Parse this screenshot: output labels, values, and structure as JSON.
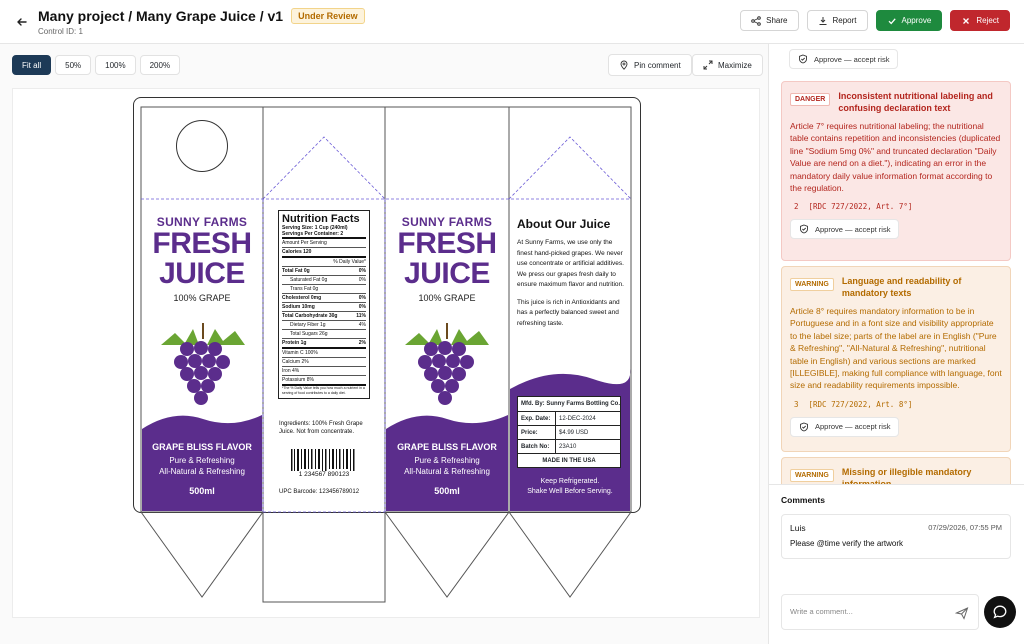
{
  "header": {
    "title": "Many project / Many Grape Juice / v1",
    "status_badge": "Under Review",
    "control_id": "Control ID: 1",
    "share": "Share",
    "report": "Report",
    "approve": "Approve",
    "reject": "Reject"
  },
  "toolbar": {
    "zoom": [
      "Fit all",
      "50%",
      "100%",
      "200%"
    ],
    "pin_comment": "Pin comment",
    "maximize": "Maximize"
  },
  "artwork": {
    "brand_top": "SUNNY FARMS",
    "brand_line1": "FRESH",
    "brand_line2": "JUICE",
    "brand_sub": "100% GRAPE",
    "flavor": "GRAPE BLISS FLAVOR",
    "tag1": "Pure & Refreshing",
    "tag2": "All-Natural & Refreshing",
    "volume": "500ml",
    "nutrition": {
      "title": "Nutrition Facts",
      "serving_size": "Serving Size: 1 Cup (240ml)",
      "servings": "Servings Per Container: 2",
      "amount": "Amount Per Serving",
      "calories": "Calories 120",
      "dv_header": "% Daily Value*",
      "rows": [
        {
          "label": "Total Fat 0g",
          "value": "0%"
        },
        {
          "label": "Saturated Fat 0g",
          "value": "0%"
        },
        {
          "label": "Trans Fat 0g",
          "value": ""
        },
        {
          "label": "Cholesterol 0mg",
          "value": "0%"
        },
        {
          "label": "Sodium 10mg",
          "value": "0%"
        },
        {
          "label": "Total Carbohydrate 30g",
          "value": "11%"
        },
        {
          "label": "Dietary Fiber 1g",
          "value": "4%"
        },
        {
          "label": "Total Sugars 26g",
          "value": ""
        },
        {
          "label": "Protein 1g",
          "value": "2%"
        }
      ],
      "vitamins": [
        "Vitamin C 100%",
        "Calcium 2%",
        "Iron 4%",
        "Potassium 8%"
      ],
      "footnote": "*The % Daily Value tells you how much a nutrient in a serving of food contributes to a daily diet."
    },
    "ingredients": "Ingredients: 100% Fresh Grape Juice. Not from concentrate.",
    "barcode_digits": "1  234567  890123",
    "upc": "UPC Barcode: 123456789012",
    "about_title": "About Our Juice",
    "about_p1": "At Sunny Farms, we use only the finest hand-picked grapes. We never use concentrate or artificial additives. We press our grapes fresh daily to ensure maximum flavor and nutrition.",
    "about_p2": "This juice is rich in Antioxidants and has a perfectly balanced sweet and refreshing taste.",
    "mfd": "Mfd. By: Sunny Farms Bottling Co.",
    "exp_k": "Exp. Date:",
    "exp_v": "12-DEC-2024",
    "price_k": "Price:",
    "price_v": "$4.99 USD",
    "batch_k": "Batch No:",
    "batch_v": "23A10",
    "made_in": "MADE IN THE USA",
    "keep1": "Keep Refrigerated.",
    "keep2": "Shake Well Before Serving."
  },
  "panel": {
    "accept_risk": "Approve — accept risk",
    "cards": [
      {
        "severity": "DANGER",
        "title": "Inconsistent nutritional labeling and confusing declaration text",
        "body": "Article 7° requires nutritional labeling; the nutritional table contains repetition and inconsistencies (duplicated line \"Sodium 5mg 0%\" and truncated declaration \"Daily Value are nend on a diet.\"), indicating an error in the mandatory daily value information format according to the regulation.",
        "num": "2",
        "ref": "[RDC 727/2022, Art. 7°]"
      },
      {
        "severity": "WARNING",
        "title": "Language and readability of mandatory texts",
        "body": "Article 8° requires mandatory information to be in Portuguese and in a font size and visibility appropriate to the label size; parts of the label are in English (\"Pure & Refreshing\", \"All-Natural & Refreshing\", nutritional table in English) and various sections are marked [ILLEGIBLE], making full compliance with language, font size and readability requirements impossible.",
        "num": "3",
        "ref": "[RDC 727/2022, Art. 8°]"
      },
      {
        "severity": "WARNING",
        "title": "Missing or illegible mandatory information"
      }
    ],
    "comments_label": "Comments",
    "comment": {
      "author": "Luis",
      "date": "07/29/2026, 07:55 PM",
      "text": "Please @time verify the artwork"
    },
    "comment_placeholder": "Write a comment..."
  },
  "colors": {
    "brand_purple": "#5b2d8c",
    "approve": "#1e8a3e",
    "reject": "#c0272d",
    "zoom_active": "#1d3a57"
  }
}
